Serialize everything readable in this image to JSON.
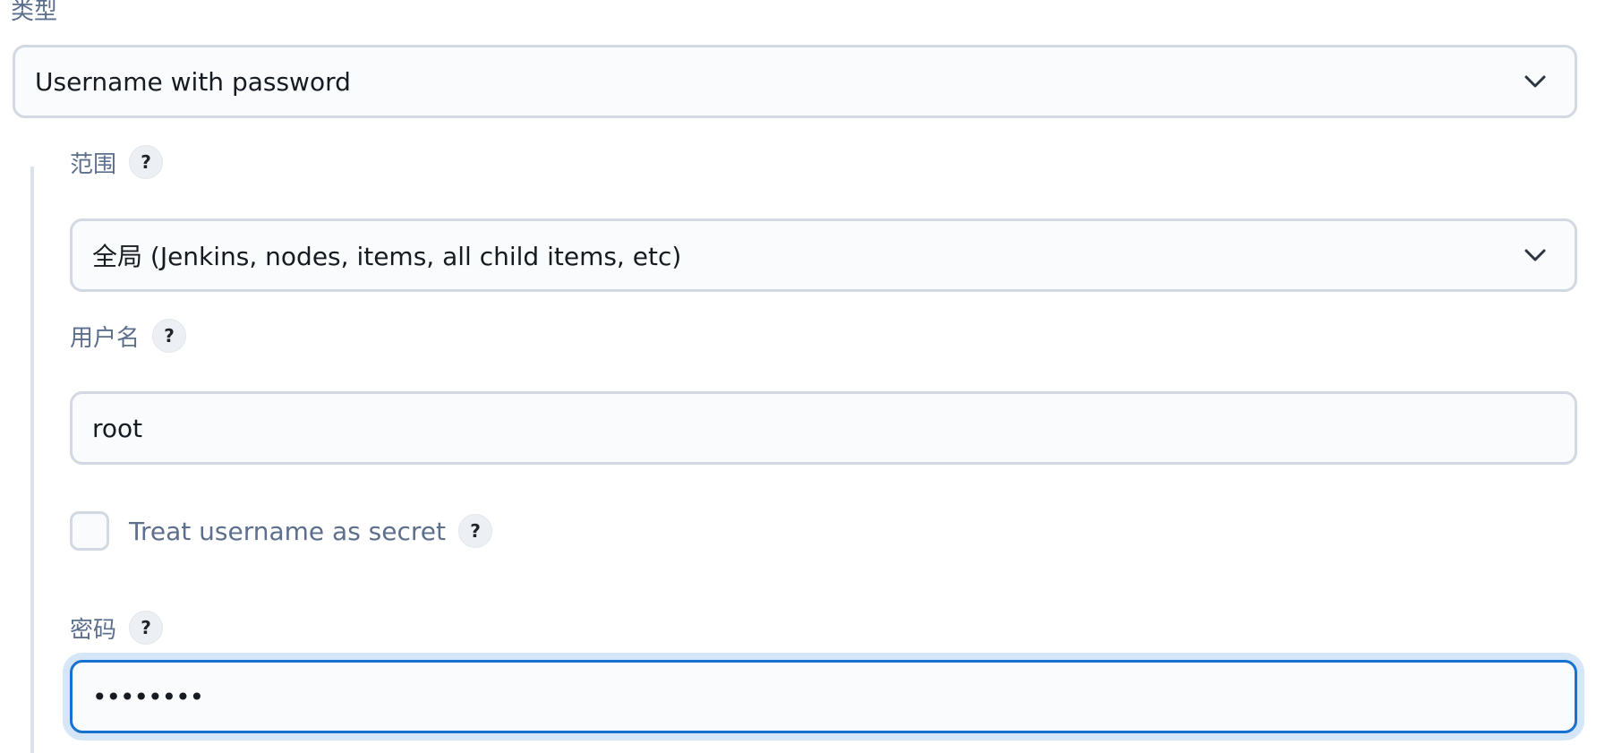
{
  "type_field": {
    "label": "类型",
    "selected": "Username with password"
  },
  "scope_field": {
    "label": "范围",
    "help": "?",
    "selected": "全局 (Jenkins, nodes, items, all child items, etc)"
  },
  "username_field": {
    "label": "用户名",
    "help": "?",
    "value": "root"
  },
  "treat_secret": {
    "label": "Treat username as secret",
    "help": "?",
    "checked": false
  },
  "password_field": {
    "label": "密码",
    "help": "?",
    "masked_value": "••••••••"
  },
  "colors": {
    "label_text": "#5c6f8d",
    "input_border": "#d2d9e3",
    "focus_border": "#1671d0",
    "focus_ring": "#d4e6f8"
  },
  "icons": {
    "dropdown": "chevron-down-icon",
    "help": "help-icon"
  }
}
